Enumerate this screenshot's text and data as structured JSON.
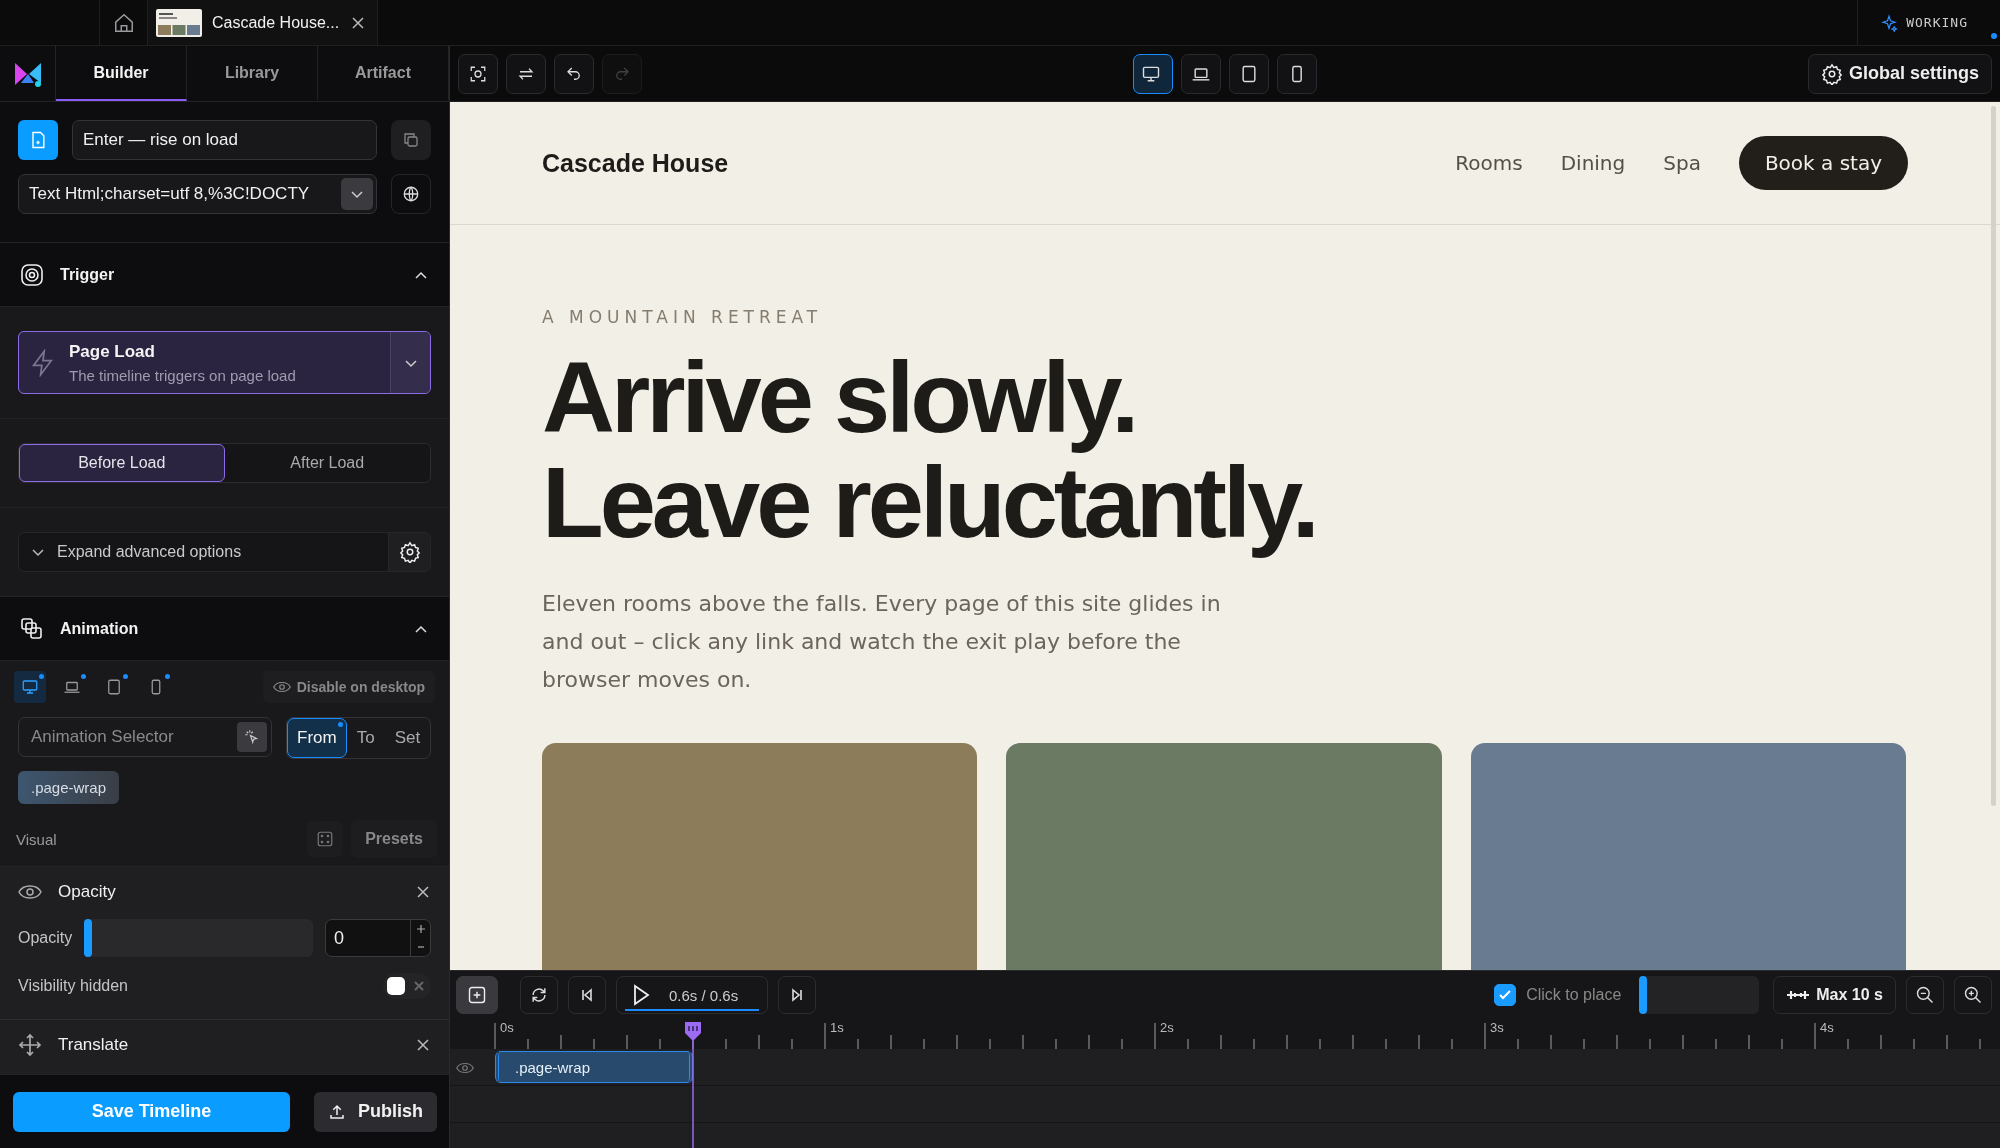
{
  "document_tab": {
    "title": "Cascade House..."
  },
  "status": {
    "label": "WORKING"
  },
  "panel_tabs": [
    {
      "label": "Builder",
      "selected": true
    },
    {
      "label": "Library",
      "selected": false
    },
    {
      "label": "Artifact",
      "selected": false
    }
  ],
  "timeline_name": {
    "value": "Enter — rise on load"
  },
  "source": {
    "value": "Text Html;charset=utf 8,%3C!DOCTY"
  },
  "trigger": {
    "title": "Trigger",
    "expanded": true,
    "event": {
      "name": "Page Load",
      "description": "The timeline triggers on page load"
    },
    "modes": [
      {
        "label": "Before Load",
        "selected": true
      },
      {
        "label": "After Load",
        "selected": false
      }
    ],
    "advanced": {
      "label": "Expand advanced options",
      "expanded": false
    }
  },
  "animation": {
    "title": "Animation",
    "expanded": true,
    "devices": [
      {
        "kind": "desktop",
        "selected": true
      },
      {
        "kind": "laptop",
        "selected": false
      },
      {
        "kind": "tablet",
        "selected": false
      },
      {
        "kind": "phone",
        "selected": false
      }
    ],
    "disable_label": "Disable on desktop",
    "selector_placeholder": "Animation Selector",
    "directions": [
      {
        "label": "From",
        "selected": true
      },
      {
        "label": "To",
        "selected": false
      },
      {
        "label": "Set",
        "selected": false
      }
    ],
    "targets": [
      ".page-wrap"
    ],
    "visual_label": "Visual",
    "presets_label": "Presets",
    "properties": [
      {
        "kind": "opacity",
        "name": "Opacity",
        "slider_label": "Opacity",
        "level": 0,
        "value": "0",
        "toggle_label": "Visibility hidden",
        "toggle_on": false
      },
      {
        "kind": "translate",
        "name": "Translate"
      }
    ]
  },
  "footer": {
    "save": "Save Timeline",
    "publish": "Publish"
  },
  "toolbar": {
    "devices": [
      {
        "kind": "desktop",
        "selected": true
      },
      {
        "kind": "laptop",
        "selected": false
      },
      {
        "kind": "tablet",
        "selected": false
      },
      {
        "kind": "phone",
        "selected": false
      }
    ],
    "global_settings": "Global settings"
  },
  "preview": {
    "brand": "Cascade House",
    "nav": [
      "Rooms",
      "Dining",
      "Spa"
    ],
    "cta": "Book a stay",
    "eyebrow": "A MOUNTAIN RETREAT",
    "headline": [
      "Arrive slowly.",
      "Leave reluctantly."
    ],
    "body": "Eleven rooms above the falls. Every page of this site glides in and out – click any link and watch the exit play before the browser moves on.",
    "cards": [
      {
        "color": "#8c7c5a"
      },
      {
        "color": "#6b7a62"
      },
      {
        "color": "#687b91"
      }
    ]
  },
  "timeline": {
    "time": "0.6s / 0.6s",
    "snap": {
      "label": "Click to place",
      "checked": true,
      "level": 0
    },
    "max": "Max 10 s",
    "ruler": [
      "0s",
      "1s",
      "2s",
      "3s",
      "4s"
    ],
    "playhead": {
      "level": 0.1316
    },
    "tracks": [
      {
        "label": ".page-wrap",
        "visible": true
      }
    ]
  }
}
